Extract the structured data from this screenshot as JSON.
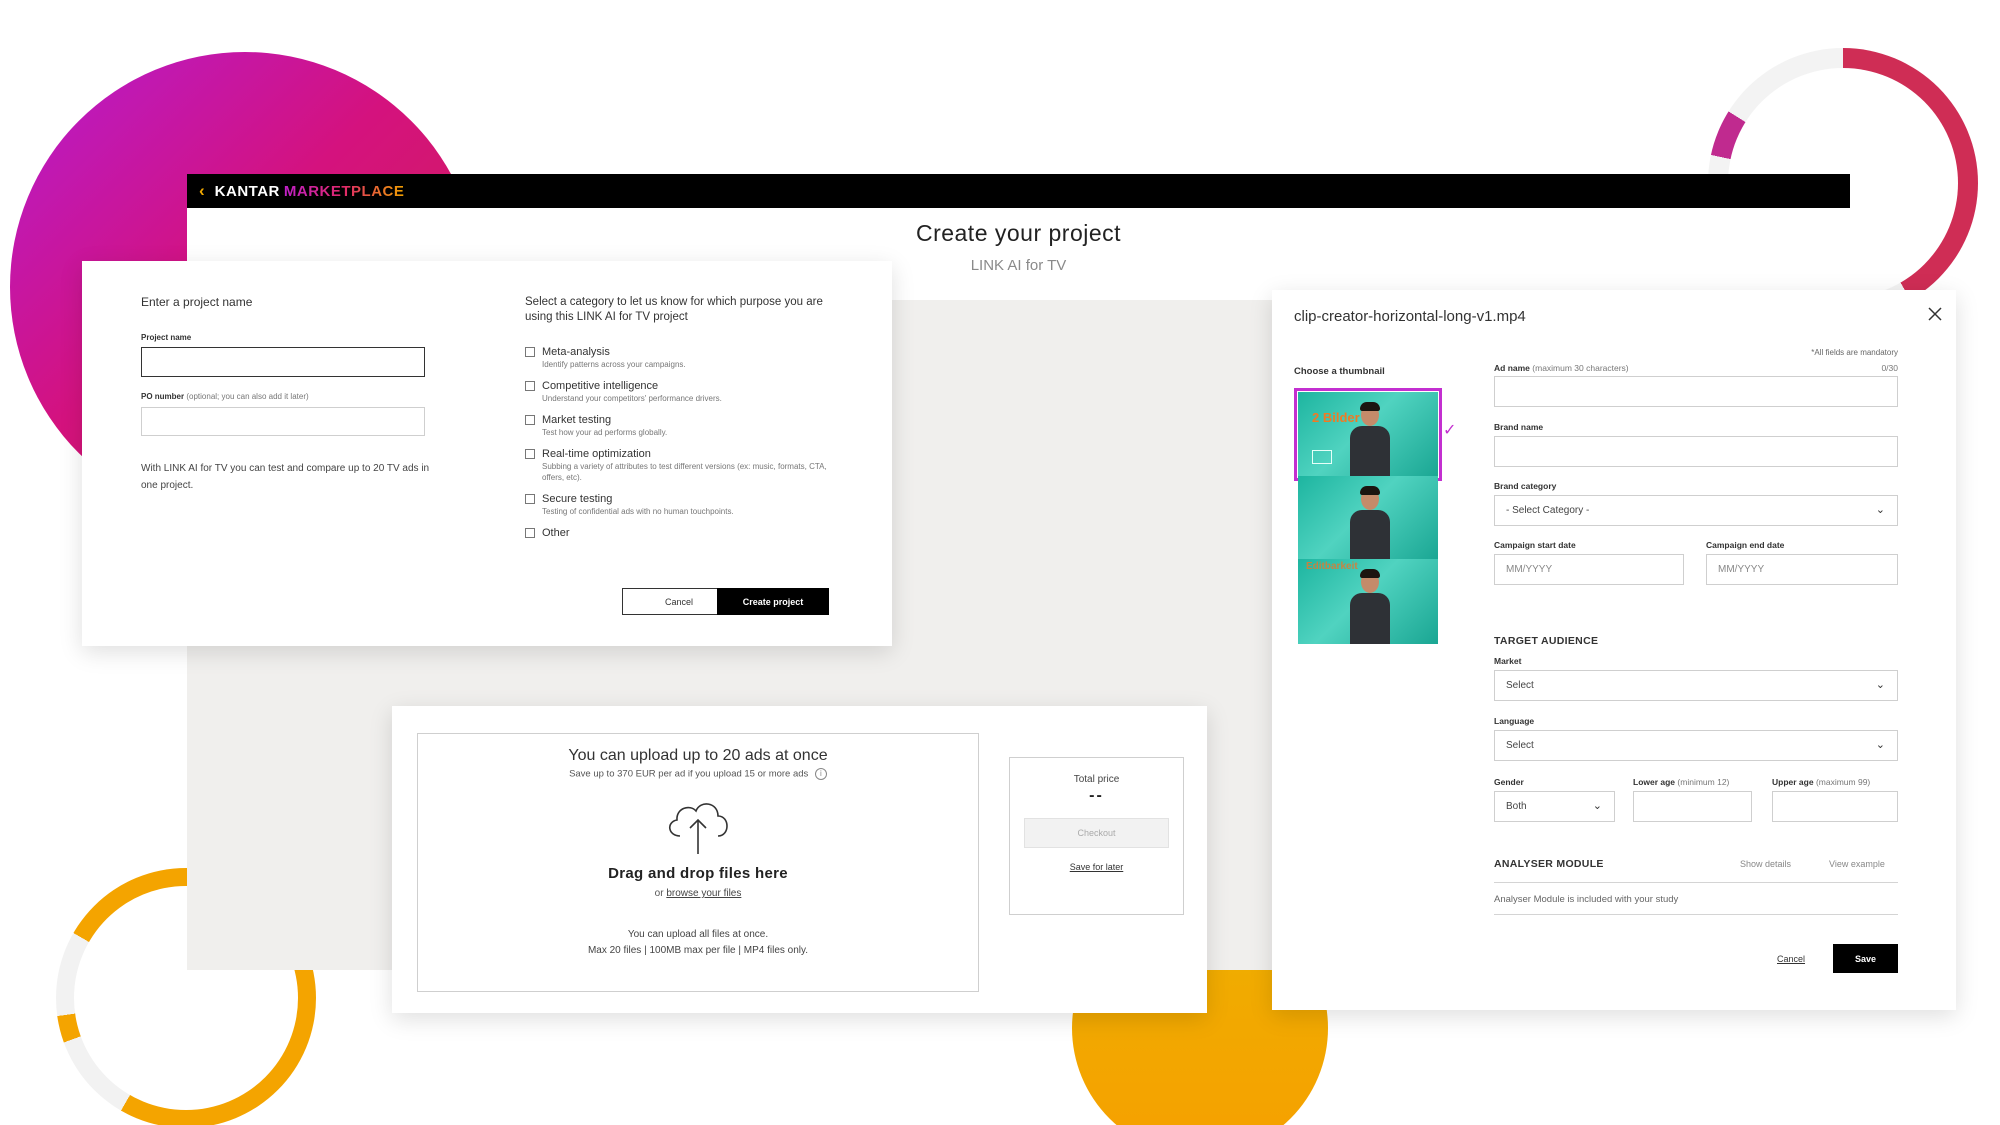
{
  "topbar": {
    "back_icon": "chevron-left-icon",
    "brand_primary": "KANTAR",
    "brand_secondary": "MARKETPLACE"
  },
  "header": {
    "title": "Create your project",
    "subtitle": "LINK AI for TV"
  },
  "project_form": {
    "heading": "Enter a project name",
    "project_name_label": "Project name",
    "project_name_value": "",
    "po_label": "PO number",
    "po_hint": "(optional; you can also add it later)",
    "po_value": "",
    "note": "With LINK AI for TV you can test and compare up to 20 TV ads in one project.",
    "category_heading": "Select a category to let us know for which purpose you are using this LINK AI for TV project",
    "categories": [
      {
        "title": "Meta-analysis",
        "desc": "Identify patterns across your campaigns."
      },
      {
        "title": "Competitive intelligence",
        "desc": "Understand your competitors' performance drivers."
      },
      {
        "title": "Market testing",
        "desc": "Test how your ad performs globally."
      },
      {
        "title": "Real-time optimization",
        "desc": "Subbing a variety of attributes to test different versions (ex: music, formats, CTA, offers, etc)."
      },
      {
        "title": "Secure testing",
        "desc": "Testing of confidential ads with no human touchpoints."
      },
      {
        "title": "Other",
        "desc": ""
      }
    ],
    "cancel_label": "Cancel",
    "create_label": "Create project"
  },
  "upload": {
    "heading": "You can upload up to 20 ads at once",
    "subheading": "Save up to 370 EUR per ad if you upload 15 or more ads",
    "info_icon": "i",
    "drop_label": "Drag and drop files here",
    "or_text": "or",
    "browse_label": "browse your files",
    "footer1": "You can upload all files at once.",
    "footer2": "Max 20 files | 100MB max per file | MP4 files only.",
    "total_price_label": "Total price",
    "total_price_value": "--",
    "checkout_label": "Checkout",
    "save_later_label": "Save for later"
  },
  "detail": {
    "file_name": "clip-creator-horizontal-long-v1.mp4",
    "close_icon": "close-icon",
    "mandatory_note": "*All fields are mandatory",
    "thumbnail_label": "Choose a thumbnail",
    "thumb1_text": "2 Bilder",
    "thumb3_text": "Editbarkeit",
    "ad_name_label": "Ad name",
    "ad_name_hint": "(maximum 30 characters)",
    "ad_name_counter": "0/30",
    "brand_name_label": "Brand name",
    "brand_category_label": "Brand category",
    "brand_category_value": "- Select Category -",
    "start_label": "Campaign start date",
    "start_placeholder": "MM/YYYY",
    "end_label": "Campaign end date",
    "end_placeholder": "MM/YYYY",
    "target_audience_heading": "TARGET AUDIENCE",
    "market_label": "Market",
    "market_value": "Select",
    "language_label": "Language",
    "language_value": "Select",
    "gender_label": "Gender",
    "gender_value": "Both",
    "lower_age_label": "Lower age",
    "lower_age_hint": "(minimum 12)",
    "upper_age_label": "Upper age",
    "upper_age_hint": "(maximum 99)",
    "analyser_heading": "ANALYSER MODULE",
    "show_details_label": "Show details",
    "view_example_label": "View example",
    "analyser_text": "Analyser Module is included with your study",
    "cancel_label": "Cancel",
    "save_label": "Save"
  },
  "colors": {
    "brand_magenta": "#c32fd0",
    "brand_orange": "#f2a900",
    "teal": "#1db5a0"
  }
}
